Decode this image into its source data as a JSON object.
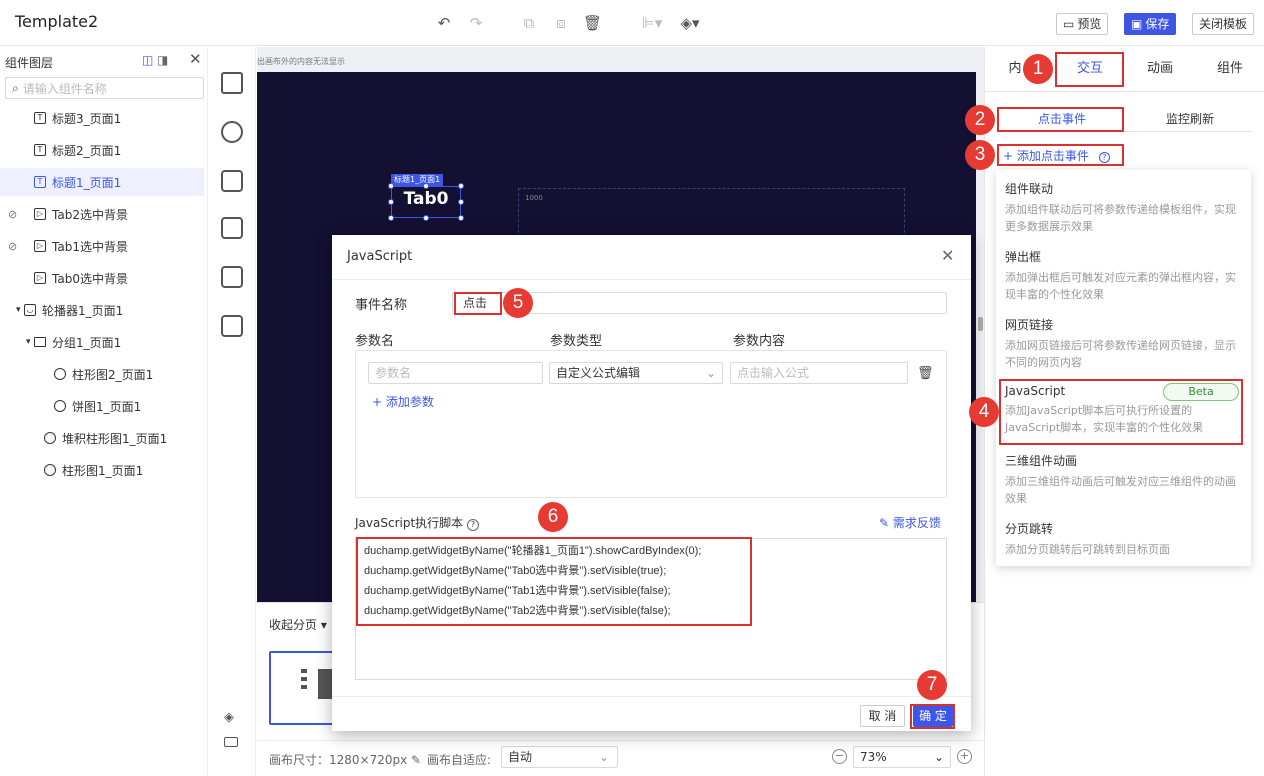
{
  "app": {
    "title": "Template2"
  },
  "toolbar": {
    "preview_label": "预览",
    "save_label": "保存",
    "close_label": "关闭模板"
  },
  "left_panel": {
    "title": "组件图层",
    "search_placeholder": "请输入组件名称",
    "layers": [
      {
        "label": "标题3_页面1",
        "icon": "text-icon"
      },
      {
        "label": "标题2_页面1",
        "icon": "text-icon"
      },
      {
        "label": "标题1_页面1",
        "icon": "text-icon",
        "selected": true
      },
      {
        "label": "Tab2选中背景",
        "icon": "media-icon",
        "hidden": true
      },
      {
        "label": "Tab1选中背景",
        "icon": "media-icon",
        "hidden": true
      },
      {
        "label": "Tab0选中背景",
        "icon": "media-icon"
      },
      {
        "label": "轮播器1_页面1",
        "icon": "carousel-icon",
        "expanded": true
      },
      {
        "label": "分组1_页面1",
        "icon": "folder-icon",
        "expanded": true
      },
      {
        "label": "柱形图2_页面1",
        "icon": "chart-icon"
      },
      {
        "label": "饼图1_页面1",
        "icon": "chart-icon"
      },
      {
        "label": "堆积柱形图1_页面1",
        "icon": "chart-icon"
      },
      {
        "label": "柱形图1_页面1",
        "icon": "chart-icon"
      }
    ]
  },
  "canvas": {
    "hint": "出画布外的内容无法显示",
    "widget_tag": "标题1_页面1",
    "widget_text": "Tab0",
    "dash_label": "1000"
  },
  "pages": {
    "collapse_label": "收起分页"
  },
  "status": {
    "canvas_size": "画布尺寸：1280×720px",
    "fit_label": "画布自适应:",
    "fit_value": "自动",
    "zoom": "73%"
  },
  "right_panel": {
    "tabs": [
      "内",
      "交互",
      "动画",
      "组件"
    ],
    "subtabs": [
      "点击事件",
      "监控刷新"
    ],
    "add_event": "添加点击事件",
    "options": [
      {
        "title": "组件联动",
        "desc": "添加组件联动后可将参数传递给模板组件，实现更多数据展示效果"
      },
      {
        "title": "弹出框",
        "desc": "添加弹出框后可触发对应元素的弹出框内容，实现丰富的个性化效果"
      },
      {
        "title": "网页链接",
        "desc": "添加网页链接后可将参数传递给网页链接，显示不同的网页内容"
      },
      {
        "title": "JavaScript",
        "desc": "添加JavaScript脚本后可执行所设置的JavaScript脚本，实现丰富的个性化效果",
        "badge": "Beta"
      },
      {
        "title": "三维组件动画",
        "desc": "添加三维组件动画后可触发对应三维组件的动画效果"
      },
      {
        "title": "分页跳转",
        "desc": "添加分页跳转后可跳转到目标页面"
      }
    ]
  },
  "modal": {
    "title": "JavaScript",
    "event_name_label": "事件名称",
    "event_name_value": "点击",
    "col_param_name": "参数名",
    "col_param_type": "参数类型",
    "col_param_content": "参数内容",
    "param_name_placeholder": "参数名",
    "param_type_value": "自定义公式编辑",
    "param_content_placeholder": "点击输入公式",
    "add_param": "添加参数",
    "script_label": "JavaScript执行脚本",
    "feedback": "需求反馈",
    "code": [
      "duchamp.getWidgetByName(\"轮播器1_页面1\").showCardByIndex(0);",
      "duchamp.getWidgetByName(\"Tab0选中背景\").setVisible(true);",
      "duchamp.getWidgetByName(\"Tab1选中背景\").setVisible(false);",
      "duchamp.getWidgetByName(\"Tab2选中背景\").setVisible(false);"
    ],
    "cancel": "取 消",
    "ok": "确 定"
  },
  "annotations": [
    "1",
    "2",
    "3",
    "4",
    "5",
    "6",
    "7"
  ],
  "colors": {
    "accent": "#3d56e6",
    "annotation": "#e63a32",
    "canvas_bg": "#131031"
  }
}
